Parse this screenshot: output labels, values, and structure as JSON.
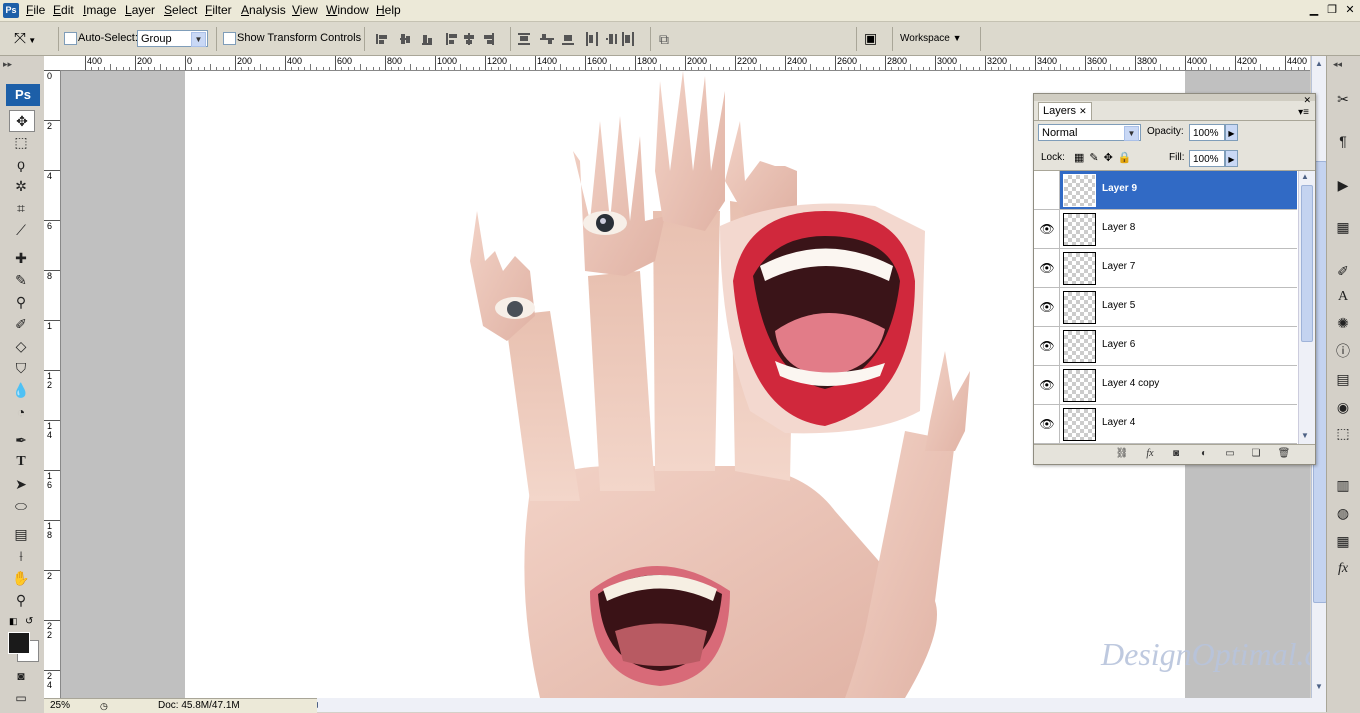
{
  "app": {
    "logo": "Ps"
  },
  "menu": [
    "File",
    "Edit",
    "Image",
    "Layer",
    "Select",
    "Filter",
    "Analysis",
    "View",
    "Window",
    "Help"
  ],
  "window_controls": {
    "minimize": "▁",
    "restore": "❐",
    "close": "✕"
  },
  "options": {
    "auto_select_label": "Auto-Select:",
    "auto_select_value": "Group",
    "show_transform_label": "Show Transform Controls",
    "workspace_label": "Workspace"
  },
  "ruler_h": [
    "400",
    "200",
    "0",
    "200",
    "400",
    "600",
    "800",
    "1000",
    "1200",
    "1400",
    "1600",
    "1800",
    "2000",
    "2200",
    "2400",
    "2600",
    "2800",
    "3000",
    "3200",
    "3400",
    "3600",
    "3800",
    "4000",
    "4200",
    "4400"
  ],
  "ruler_v": [
    "0",
    "2",
    "4",
    "6",
    "8",
    "1",
    "1 2",
    "1 4",
    "1 6",
    "1 8",
    "2",
    "2 2",
    "2 4"
  ],
  "status": {
    "zoom": "25%",
    "doc": "Doc: 45.8M/47.1M"
  },
  "layers_panel": {
    "tab": "Layers",
    "blend_mode": "Normal",
    "opacity_label": "Opacity:",
    "opacity_value": "100%",
    "lock_label": "Lock:",
    "fill_label": "Fill:",
    "fill_value": "100%",
    "layers": [
      {
        "name": "Layer 9",
        "selected": true
      },
      {
        "name": "Layer 8",
        "selected": false
      },
      {
        "name": "Layer 7",
        "selected": false
      },
      {
        "name": "Layer 5",
        "selected": false
      },
      {
        "name": "Layer 6",
        "selected": false
      },
      {
        "name": "Layer 4 copy",
        "selected": false
      },
      {
        "name": "Layer 4",
        "selected": false
      }
    ],
    "footer_icons": [
      "link-icon",
      "fx-icon",
      "mask-icon",
      "adjustment-icon",
      "group-folder-icon",
      "new-layer-icon",
      "trash-icon"
    ]
  },
  "watermark": "DesignOptimal.com",
  "colors": {
    "selection": "#316ac5",
    "ps_blue": "#1d5fa8",
    "lips": "#d0283c"
  }
}
